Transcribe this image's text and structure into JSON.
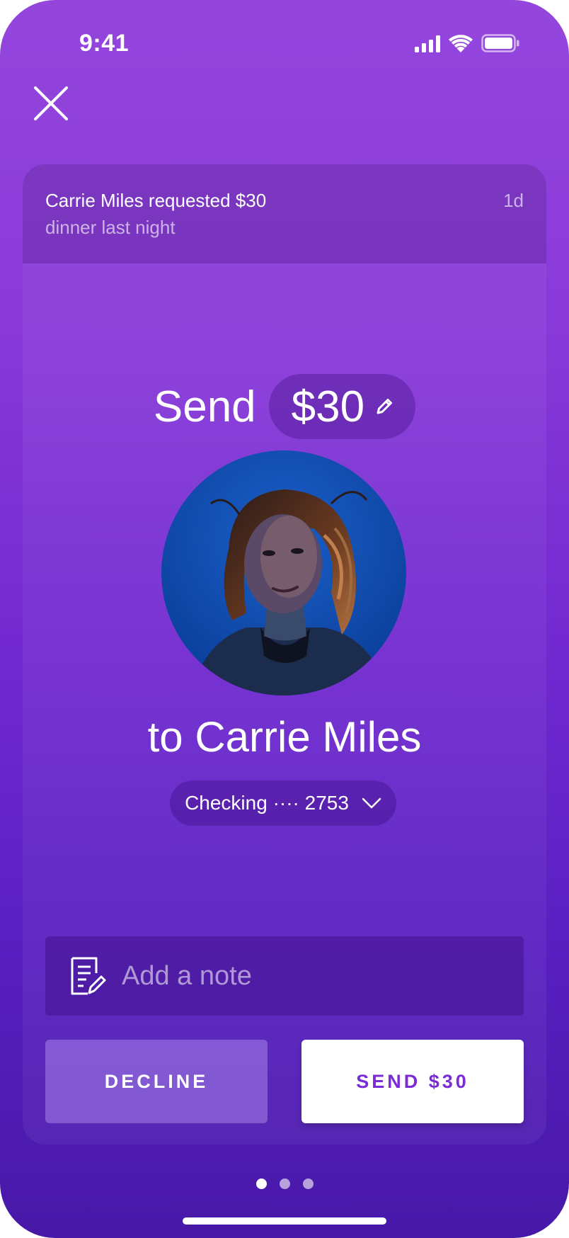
{
  "status_bar": {
    "time": "9:41"
  },
  "request": {
    "title": "Carrie Miles requested $30",
    "subtitle": "dinner last night",
    "age": "1d"
  },
  "payment": {
    "send_word": "Send",
    "amount": "$30",
    "recipient_line": "to Carrie Miles",
    "account": "Checking ···· 2753"
  },
  "note": {
    "placeholder": "Add a note",
    "value": ""
  },
  "actions": {
    "decline_label": "DECLINE",
    "send_label": "SEND $30"
  },
  "pagination": {
    "total": 3,
    "active_index": 0
  },
  "icons": {
    "close": "close-icon",
    "edit": "pencil-icon",
    "chevron": "chevron-down-icon",
    "note": "note-icon",
    "signal": "cellular-signal-icon",
    "wifi": "wifi-icon",
    "battery": "battery-icon"
  },
  "colors": {
    "gradient_top": "#9446dc",
    "gradient_bottom": "#4718a8",
    "send_button_text": "#7b2bd6"
  }
}
